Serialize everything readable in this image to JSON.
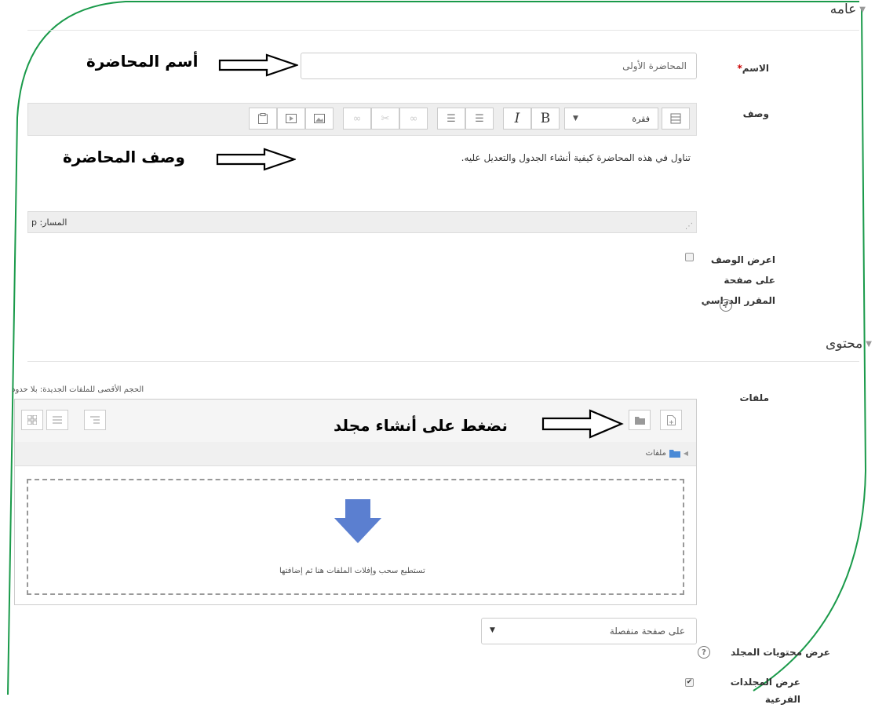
{
  "general": {
    "section_title": "عامه"
  },
  "name_field": {
    "label": "الاسم",
    "required_mark": "*",
    "value": "المحاضرة الأولى"
  },
  "description_field": {
    "label": "وصف",
    "paragraph_select": "فقرة",
    "content": "تناول في هذه المحاضرة كيفية أنشاء الجدول والتعديل عليه.",
    "path": "المسار: p",
    "toolbar_bold": "B",
    "toolbar_italic": "I"
  },
  "show_description": {
    "label_line1": "اعرض الوصف على صفحة",
    "label_line2": "المقرر الدراسي"
  },
  "content_section": {
    "section_title": "محتوى"
  },
  "files_field": {
    "label": "ملفات",
    "max_size": "الحجم الأقصى للملفات الجديدة: بلا حدود",
    "folder_path": "ملفات",
    "drop_hint": "تستطيع سحب وإفلات الملفات هنا ثم إضافتها"
  },
  "display_contents": {
    "label": "عرض محتويات المجلد",
    "selected": "على صفحة منفصلة"
  },
  "subfolders": {
    "label": "عرض المجلدات الفرعية"
  },
  "annotations": {
    "name_note": "أسم المحاضرة",
    "description_note": "وصف المحاضرة",
    "folder_note": "نضغط على أنشاء مجلد"
  },
  "colors": {
    "frame": "#1a9a4a",
    "upload_arrow": "#5b7fd0",
    "required": "#cc0000"
  }
}
